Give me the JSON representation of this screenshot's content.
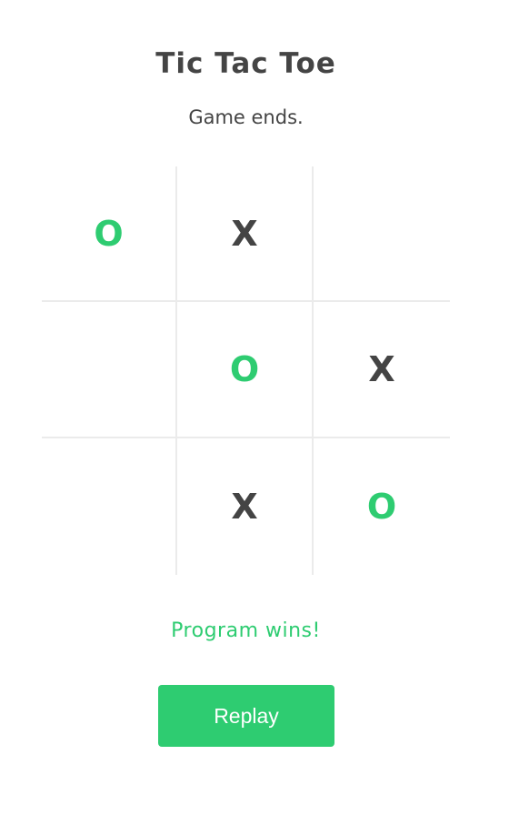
{
  "title": "Tic Tac Toe",
  "status": "Game ends.",
  "board": [
    [
      "O",
      "X",
      ""
    ],
    [
      "",
      "O",
      "X"
    ],
    [
      "",
      "X",
      "O"
    ]
  ],
  "result": "Program wins!",
  "replay_label": "Replay",
  "colors": {
    "accent": "#2ecc71",
    "text": "#444444",
    "grid": "#ebebeb",
    "background": "#ffffff"
  }
}
